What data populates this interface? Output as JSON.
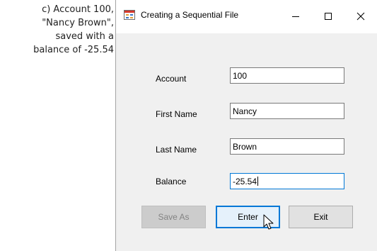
{
  "caption": {
    "lines": [
      "c) Account 100,",
      "\"Nancy Brown\",",
      "saved with a",
      "balance of -25.54"
    ]
  },
  "window": {
    "title": "Creating a Sequential File",
    "controls": {
      "minimize": "—",
      "maximize": "☐",
      "close": "✕"
    }
  },
  "form": {
    "account_label": "Account",
    "account_value": "100",
    "first_name_label": "First Name",
    "first_name_value": "Nancy",
    "last_name_label": "Last Name",
    "last_name_value": "Brown",
    "balance_label": "Balance",
    "balance_value": "-25.54"
  },
  "buttons": {
    "save_as": "Save As",
    "enter": "Enter",
    "exit": "Exit"
  },
  "colors": {
    "focus_accent": "#0078d7",
    "disabled_text": "#838383"
  },
  "icons": {
    "app": "form-app-icon",
    "cursor": "mouse-pointer-icon"
  }
}
